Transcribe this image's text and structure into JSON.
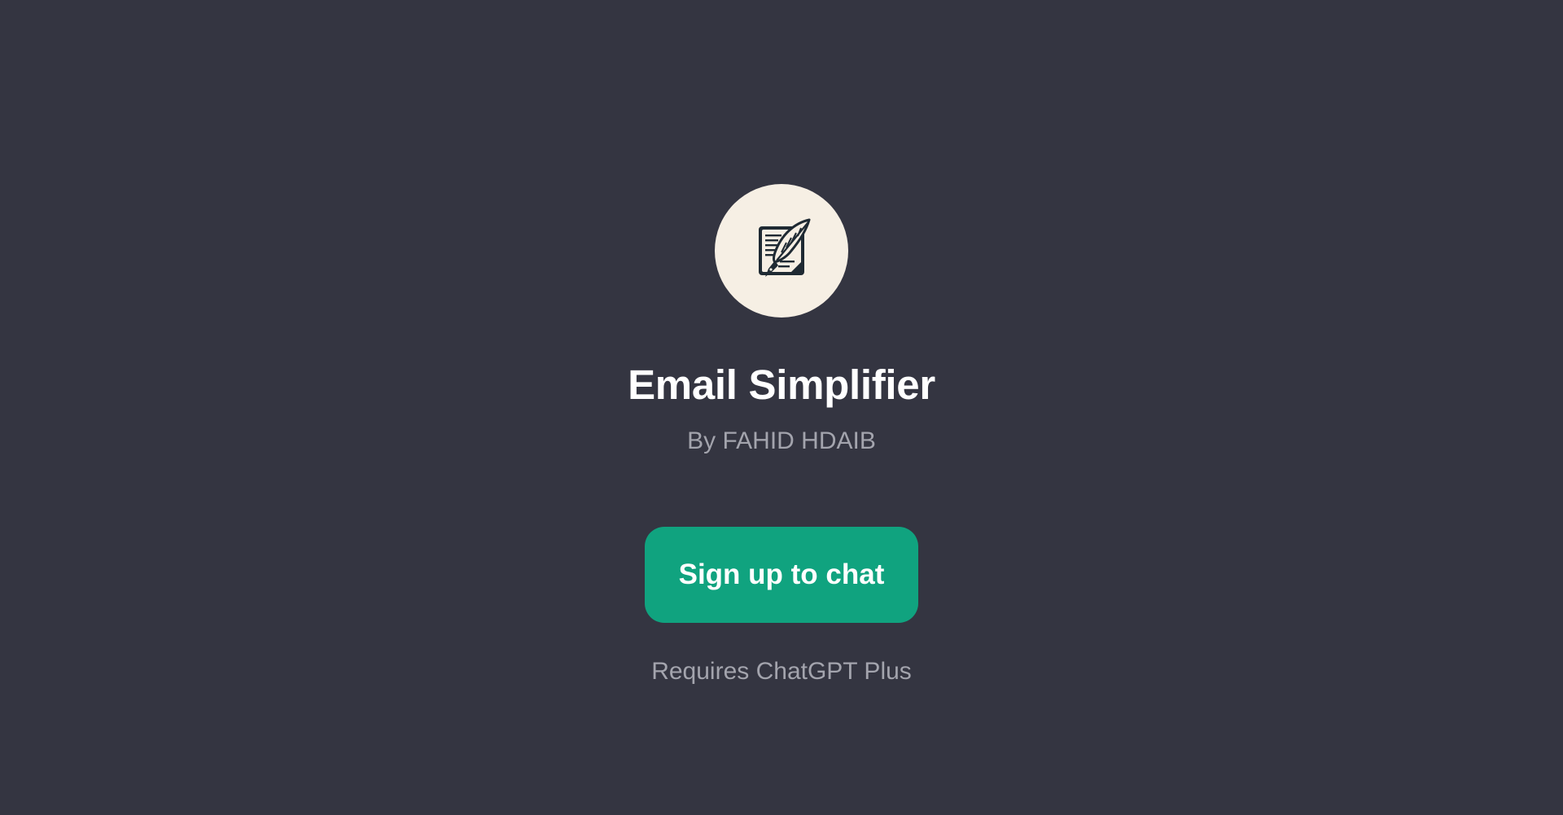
{
  "gpt": {
    "title": "Email Simplifier",
    "author_line": "By FAHID HDAIB",
    "avatar_icon": "quill-document-icon"
  },
  "cta": {
    "label": "Sign up to chat"
  },
  "footer": {
    "requirement": "Requires ChatGPT Plus"
  },
  "colors": {
    "background": "#343541",
    "avatar_background": "#f6efe4",
    "icon_ink": "#1f2a33",
    "button": "#10a37f",
    "muted_text": "#a3a4ad",
    "title_text": "#ffffff"
  }
}
